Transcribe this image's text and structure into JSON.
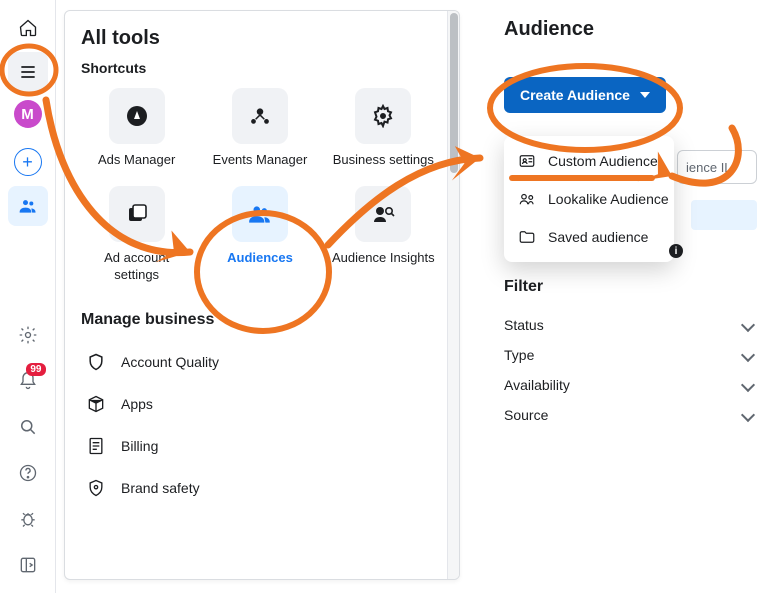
{
  "rail": {
    "avatar_letter": "M",
    "plus_glyph": "+",
    "notif_badge": "99"
  },
  "tools_panel": {
    "title": "All tools",
    "shortcuts_label": "Shortcuts",
    "tiles": [
      {
        "label": "Ads Manager"
      },
      {
        "label": "Events Manager"
      },
      {
        "label": "Business settings"
      },
      {
        "label": "Ad account settings"
      },
      {
        "label": "Audiences",
        "selected": true
      },
      {
        "label": "Audience Insights"
      }
    ],
    "manage_label": "Manage business",
    "manage_items": [
      {
        "label": "Account Quality"
      },
      {
        "label": "Apps"
      },
      {
        "label": "Billing"
      },
      {
        "label": "Brand safety"
      }
    ]
  },
  "audience_panel": {
    "title": "Audience",
    "create_button": "Create Audience",
    "dropdown": [
      {
        "label": "Custom Audience"
      },
      {
        "label": "Lookalike Audience"
      },
      {
        "label": "Saved audience"
      }
    ],
    "search_placeholder_fragment": "ience IL",
    "info_glyph": "i",
    "filter_title": "Filter",
    "filters": [
      {
        "label": "Status"
      },
      {
        "label": "Type"
      },
      {
        "label": "Availability"
      },
      {
        "label": "Source"
      }
    ]
  },
  "colors": {
    "accent": "#1877f2",
    "button": "#0a65c2",
    "annotation": "#ee7522"
  }
}
